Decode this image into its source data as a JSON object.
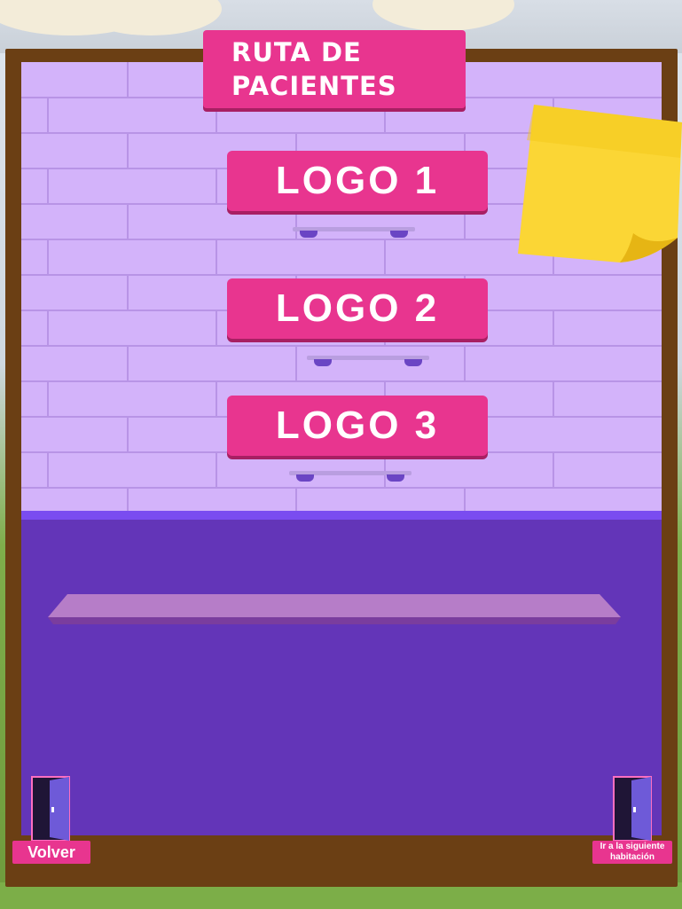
{
  "title": "RUTA DE\nPACIENTES",
  "logos": [
    {
      "label": "LOGO 1"
    },
    {
      "label": "LOGO 2"
    },
    {
      "label": "LOGO 3"
    }
  ],
  "nav": {
    "back_label": "Volver",
    "next_label": "Ir a la siguiente habitación"
  },
  "colors": {
    "wall": "#d3b3fa",
    "floor": "#6335b8",
    "frame": "#6b3f14",
    "button": "#e8358f",
    "sticky_note": "#fbd635"
  }
}
